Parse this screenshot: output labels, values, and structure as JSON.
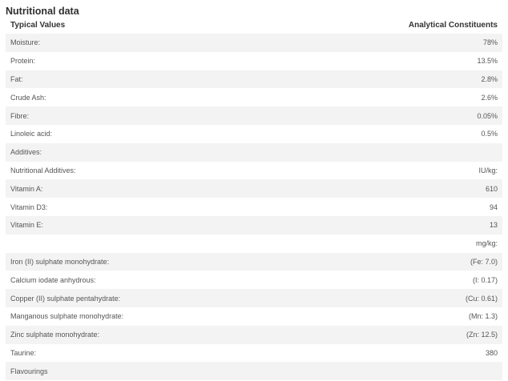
{
  "title": "Nutritional data",
  "headers": {
    "left": "Typical Values",
    "right": "Analytical Constituents"
  },
  "rows": [
    {
      "label": "Moisture:",
      "value": "78%"
    },
    {
      "label": "Protein:",
      "value": "13.5%"
    },
    {
      "label": "Fat:",
      "value": "2.8%"
    },
    {
      "label": "Crude Ash:",
      "value": "2.6%"
    },
    {
      "label": "Fibre:",
      "value": "0.05%"
    },
    {
      "label": "Linoleic acid:",
      "value": "0.5%"
    },
    {
      "label": "Additives:",
      "value": ""
    },
    {
      "label": "Nutritional Additives:",
      "value": "IU/kg:"
    },
    {
      "label": "Vitamin A:",
      "value": "610"
    },
    {
      "label": "Vitamin D3:",
      "value": "94"
    },
    {
      "label": "Vitamin E:",
      "value": "13"
    },
    {
      "label": "",
      "value": "mg/kg:"
    },
    {
      "label": "Iron (II) sulphate monohydrate:",
      "value": "(Fe: 7.0)"
    },
    {
      "label": "Calcium iodate anhydrous:",
      "value": "(I: 0.17)"
    },
    {
      "label": "Copper (II) sulphate pentahydrate:",
      "value": "(Cu: 0.61)"
    },
    {
      "label": "Manganous sulphate monohydrate:",
      "value": "(Mn: 1.3)"
    },
    {
      "label": "Zinc sulphate monohydrate:",
      "value": "(Zn: 12.5)"
    },
    {
      "label": "Taurine:",
      "value": "380"
    },
    {
      "label": "Flavourings",
      "value": ""
    }
  ]
}
